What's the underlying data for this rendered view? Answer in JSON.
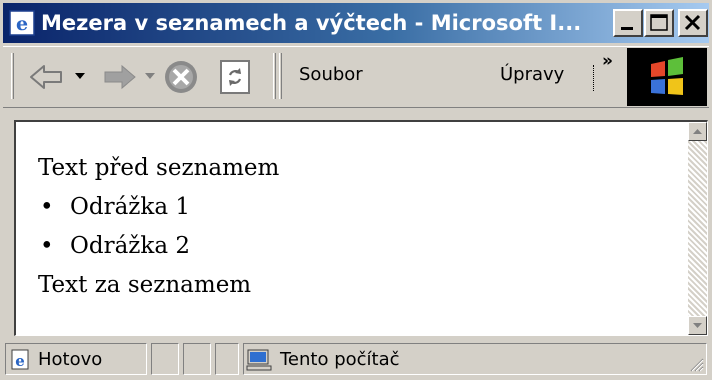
{
  "window": {
    "title": "Mezera v seznamech a výčtech - Microsoft I..."
  },
  "toolbar": {
    "menu_file": "Soubor",
    "menu_edit": "Úpravy",
    "overflow_label": "»"
  },
  "document": {
    "text_before": "Text před seznamem",
    "list_items": [
      "Odrážka 1",
      "Odrážka 2"
    ],
    "bullet": "•",
    "text_after": "Text za seznamem"
  },
  "statusbar": {
    "status": "Hotovo",
    "zone": "Tento počítač"
  },
  "colors": {
    "title_gradient_start": "#0a246a",
    "title_gradient_end": "#a6caf0",
    "face": "#d4d0c8"
  }
}
